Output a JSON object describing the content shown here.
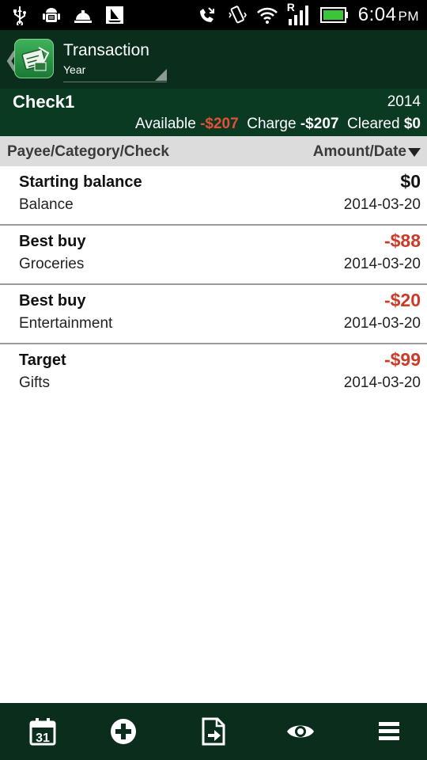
{
  "status_bar": {
    "time": "6:04",
    "ampm": "PM",
    "roaming_indicator": "R",
    "icons_left": [
      "usb-icon",
      "android-debug-icon",
      "service-bell-icon",
      "sailboat-icon"
    ],
    "icons_right": [
      "missed-call-icon",
      "vibrate-icon",
      "wifi-icon",
      "signal-icon",
      "battery-icon"
    ]
  },
  "action_bar": {
    "title": "Transaction",
    "period": "Year",
    "back_icon": "chevron-left-icon",
    "app_icon": "checkbook-app-icon"
  },
  "account": {
    "name": "Check1",
    "year": "2014",
    "available_label": "Available",
    "available_value": "-$207",
    "charge_label": "Charge",
    "charge_value": "-$207",
    "cleared_label": "Cleared",
    "cleared_value": "$0"
  },
  "columns": {
    "left": "Payee/Category/Check",
    "right": "Amount/Date"
  },
  "transactions": [
    {
      "payee": "Starting balance",
      "category": "Balance",
      "amount": "$0",
      "date": "2014-03-20"
    },
    {
      "payee": "Best buy",
      "category": "Groceries",
      "amount": "-$88",
      "date": "2014-03-20"
    },
    {
      "payee": "Best buy",
      "category": "Entertainment",
      "amount": "-$20",
      "date": "2014-03-20"
    },
    {
      "payee": "Target",
      "category": "Gifts",
      "amount": "-$99",
      "date": "2014-03-20"
    }
  ],
  "bottom_bar": {
    "calendar_day": "31",
    "icons": [
      "calendar-icon",
      "add-icon",
      "export-icon",
      "eye-icon",
      "menu-icon"
    ]
  },
  "colors": {
    "header_bg": "#0b2e1c",
    "account_bg": "#0b3a22",
    "negative": "#cc3b27",
    "column_header_bg": "#dcdcdc"
  }
}
